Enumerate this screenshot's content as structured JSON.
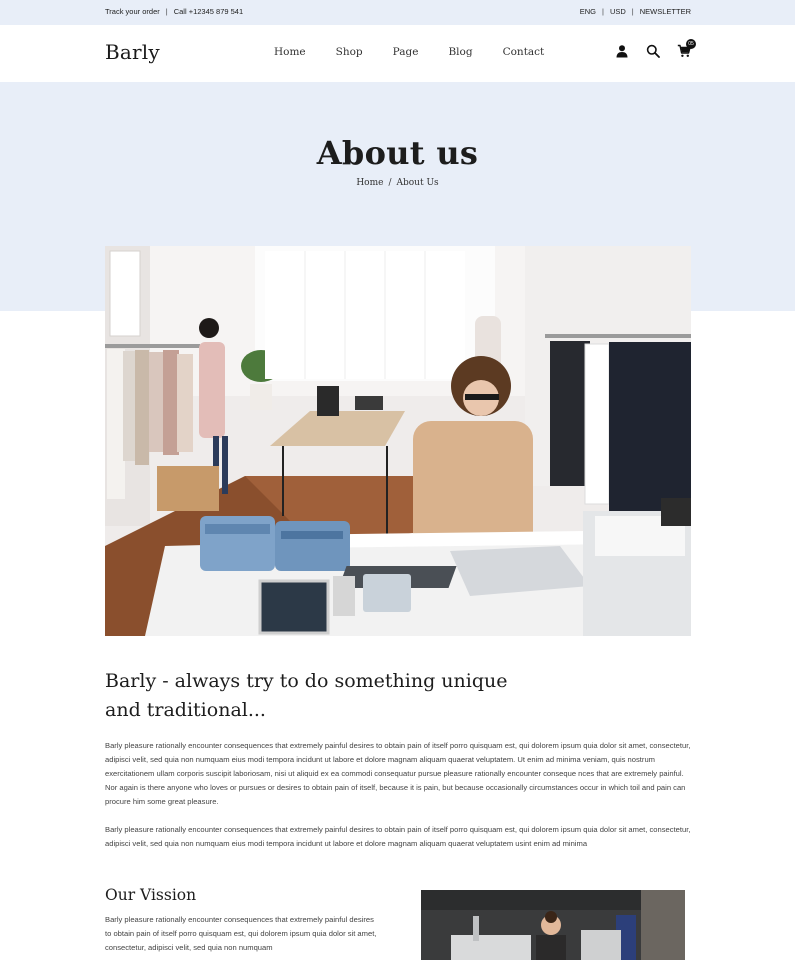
{
  "topbar": {
    "track_order": "Track your order",
    "phone": "Call +12345 879 541",
    "language": "ENG",
    "currency": "USD",
    "newsletter": "NEWSLETTER"
  },
  "header": {
    "logo": "Barly",
    "nav": [
      "Home",
      "Shop",
      "Page",
      "Blog",
      "Contact"
    ],
    "cart_count": "05",
    "icons": [
      "user-icon",
      "search-icon",
      "cart-icon"
    ]
  },
  "hero": {
    "title": "About us",
    "breadcrumb_home": "Home",
    "breadcrumb_separator": "/",
    "breadcrumb_current": "About Us"
  },
  "content": {
    "heading": "Barly - always try to do something unique and traditional...",
    "paragraph1": "Barly pleasure rationally encounter consequences that extremely painful desires to obtain pain of itself porro quisquam est, qui dolorem ipsum quia dolor sit amet, consectetur, adipisci velit, sed quia non numquam eius modi tempora incidunt ut labore et dolore magnam aliquam quaerat veluptatem. Ut enim ad minima veniam, quis nostrum exercitationem ullam corporis suscipit laboriosam, nisi ut aliquid ex ea commodi consequatur pursue pleasure rationally encounter conseque nces that are extremely painful. Nor again is there anyone who loves or pursues or desires to obtain pain of itself, because it is pain, but because occasionally circumstances occur in which toil and pain can procure him some great pleasure.",
    "paragraph2": "Barly pleasure rationally encounter consequences that extremely painful desires to obtain pain of itself porro quisquam est, qui dolorem ipsum quia dolor sit amet, consectetur, adipisci velit, sed quia non numquam eius modi tempora incidunt ut labore et dolore magnam aliquam quaerat veluptatem usint enim ad minima"
  },
  "vision": {
    "title": "Our Vission",
    "text": "Barly pleasure rationally encounter consequences that extremely painful desires to obtain pain of itself porro quisquam est, qui dolorem ipsum quia dolor sit amet, consectetur, adipisci velit, sed quia non numquam"
  },
  "colors": {
    "hero_background": "#e8eef8",
    "text_dark": "#1d1d1d",
    "text_body": "#444444"
  }
}
